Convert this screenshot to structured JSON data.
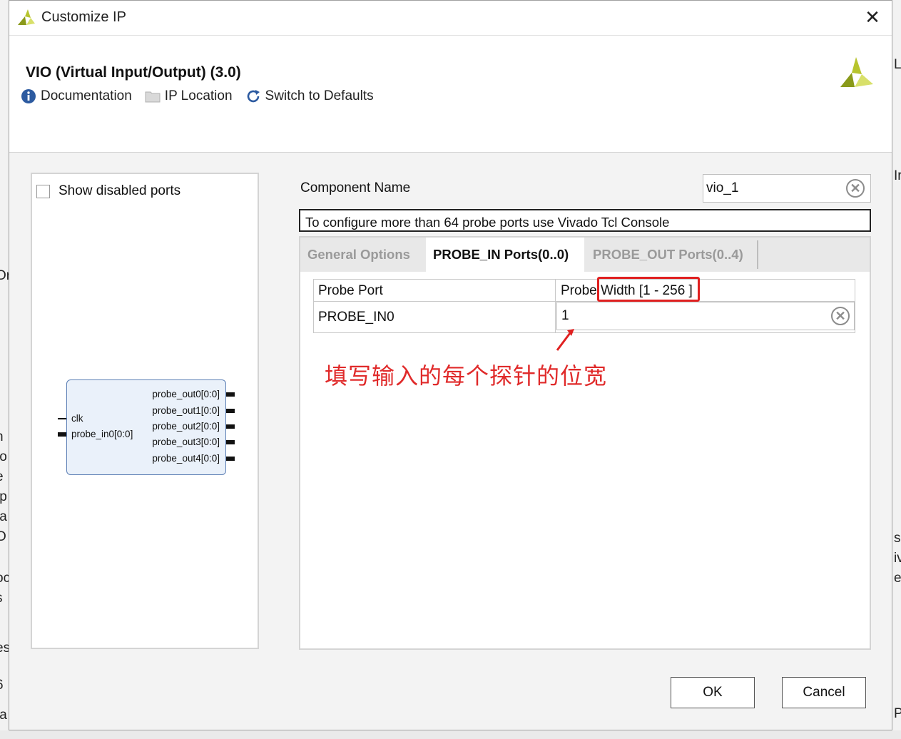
{
  "background": {
    "left_fragments": [
      "Or",
      "n",
      "to",
      "e",
      "tp",
      "fa",
      "O",
      "oc",
      "s",
      "es",
      "6",
      "ta"
    ],
    "right_fragments": [
      "L",
      "Ir",
      "s",
      "iv",
      "e",
      "P"
    ]
  },
  "window": {
    "title": "Customize IP",
    "close_glyph": "✕"
  },
  "header": {
    "ip_title": "VIO (Virtual Input/Output) (3.0)",
    "toolbar": {
      "documentation": "Documentation",
      "ip_location": "IP Location",
      "switch_defaults": "Switch to Defaults"
    }
  },
  "left_panel": {
    "show_disabled_label": "Show disabled ports",
    "block": {
      "left_pins": [
        "clk",
        "probe_in0[0:0]"
      ],
      "right_pins": [
        "probe_out0[0:0]",
        "probe_out1[0:0]",
        "probe_out2[0:0]",
        "probe_out3[0:0]",
        "probe_out4[0:0]"
      ]
    }
  },
  "form": {
    "component_name_label": "Component Name",
    "component_name_value": "vio_1",
    "info_text": "To configure more than 64 probe ports use Vivado Tcl Console",
    "tabs": [
      {
        "label": "General Options",
        "active": false
      },
      {
        "label": "PROBE_IN Ports(0..0)",
        "active": true
      },
      {
        "label": "PROBE_OUT Ports(0..4)",
        "active": false
      }
    ],
    "table": {
      "col1": "Probe Port",
      "col2": "Probe Width [1 - 256 ]",
      "rows": [
        {
          "port": "PROBE_IN0",
          "width": "1"
        }
      ]
    },
    "annotation": "填写输入的每个探针的位宽"
  },
  "buttons": {
    "ok": "OK",
    "cancel": "Cancel"
  },
  "colors": {
    "accent_red": "#e02020",
    "logo_dark": "#8a9a1a",
    "logo_light": "#d8e06a"
  },
  "icons": [
    "xilinx-logo-icon",
    "close-icon",
    "info-icon",
    "folder-icon",
    "refresh-icon",
    "clear-icon",
    "arrow-icon"
  ]
}
